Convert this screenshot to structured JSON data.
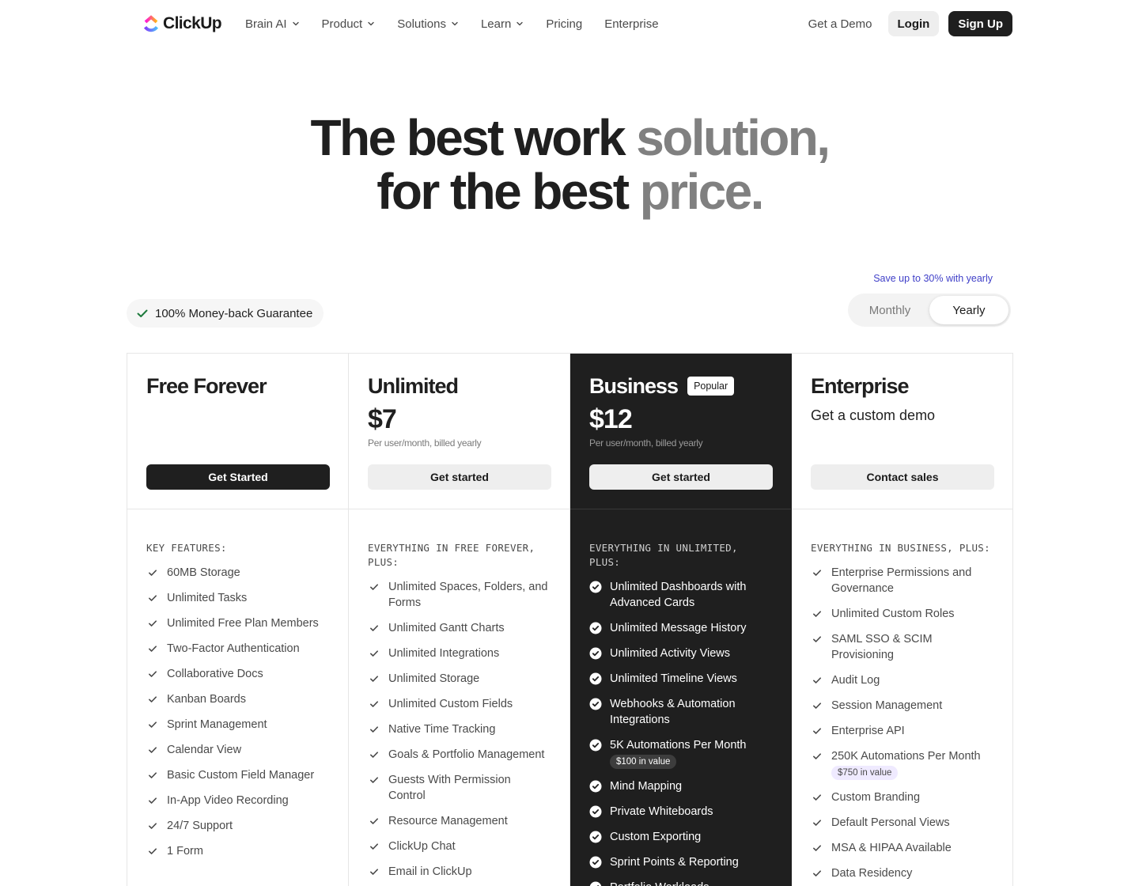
{
  "nav": {
    "brand": "ClickUp",
    "links": [
      {
        "label": "Brain AI",
        "dropdown": true
      },
      {
        "label": "Product",
        "dropdown": true
      },
      {
        "label": "Solutions",
        "dropdown": true
      },
      {
        "label": "Learn",
        "dropdown": true
      },
      {
        "label": "Pricing",
        "dropdown": false
      },
      {
        "label": "Enterprise",
        "dropdown": false
      }
    ],
    "demo": "Get a Demo",
    "login": "Login",
    "signup": "Sign Up"
  },
  "hero": {
    "line1_dark": "The best work ",
    "line1_muted": "solution,",
    "line2_dark": "for the best ",
    "line2_muted": "price."
  },
  "billing": {
    "guarantee": "100% Money-back Guarantee",
    "save_note": "Save up to 30% with yearly",
    "monthly": "Monthly",
    "yearly": "Yearly",
    "selected": "Yearly"
  },
  "plans": [
    {
      "name": "Free Forever",
      "cta": "Get Started",
      "features_title": "KEY FEATURES:",
      "features": [
        {
          "text": "60MB Storage"
        },
        {
          "text": "Unlimited Tasks"
        },
        {
          "text": "Unlimited Free Plan Members"
        },
        {
          "text": "Two-Factor Authentication"
        },
        {
          "text": "Collaborative Docs"
        },
        {
          "text": "Kanban Boards"
        },
        {
          "text": "Sprint Management"
        },
        {
          "text": "Calendar View"
        },
        {
          "text": "Basic Custom Field Manager"
        },
        {
          "text": "In-App Video Recording"
        },
        {
          "text": "24/7 Support"
        },
        {
          "text": "1 Form"
        }
      ]
    },
    {
      "name": "Unlimited",
      "price": "$7",
      "price_note": "Per user/month, billed yearly",
      "cta": "Get started",
      "features_title": "EVERYTHING IN FREE FOREVER, PLUS:",
      "features": [
        {
          "text": "Unlimited Spaces, Folders, and Forms"
        },
        {
          "text": "Unlimited Gantt Charts"
        },
        {
          "text": "Unlimited Integrations"
        },
        {
          "text": "Unlimited Storage"
        },
        {
          "text": "Unlimited Custom Fields"
        },
        {
          "text": "Native Time Tracking"
        },
        {
          "text": "Goals & Portfolio Management"
        },
        {
          "text": "Guests With Permission Control"
        },
        {
          "text": "Resource Management"
        },
        {
          "text": "ClickUp Chat"
        },
        {
          "text": "Email in ClickUp"
        }
      ]
    },
    {
      "name": "Business",
      "badge": "Popular",
      "price": "$12",
      "price_note": "Per user/month, billed yearly",
      "cta": "Get started",
      "features_title": "EVERYTHING IN UNLIMITED, PLUS:",
      "features": [
        {
          "text": "Unlimited Dashboards with Advanced Cards"
        },
        {
          "text": "Unlimited Message History"
        },
        {
          "text": "Unlimited Activity Views"
        },
        {
          "text": "Unlimited Timeline Views"
        },
        {
          "text": "Webhooks & Automation Integrations"
        },
        {
          "text": "5K Automations Per Month",
          "value": "$100 in value"
        },
        {
          "text": "Mind Mapping"
        },
        {
          "text": "Private Whiteboards"
        },
        {
          "text": "Custom Exporting"
        },
        {
          "text": "Sprint Points & Reporting"
        },
        {
          "text": "Portfolio Workloads"
        }
      ]
    },
    {
      "name": "Enterprise",
      "subtitle": "Get a custom demo",
      "cta": "Contact sales",
      "features_title": "EVERYTHING IN BUSINESS, PLUS:",
      "features": [
        {
          "text": "Enterprise Permissions and Governance"
        },
        {
          "text": "Unlimited Custom Roles"
        },
        {
          "text": "SAML SSO & SCIM Provisioning"
        },
        {
          "text": "Audit Log"
        },
        {
          "text": "Session Management"
        },
        {
          "text": "Enterprise API"
        },
        {
          "text": "250K Automations Per Month",
          "value": "$750 in value"
        },
        {
          "text": "Custom Branding"
        },
        {
          "text": "Default Personal Views"
        },
        {
          "text": "MSA & HIPAA Available"
        },
        {
          "text": "Data Residency"
        }
      ]
    }
  ],
  "colors": {
    "primary_dark": "#1f1f1f",
    "muted_text": "#808080",
    "save_link": "#3f3fc8",
    "guarantee_check": "#1e7a3c"
  }
}
